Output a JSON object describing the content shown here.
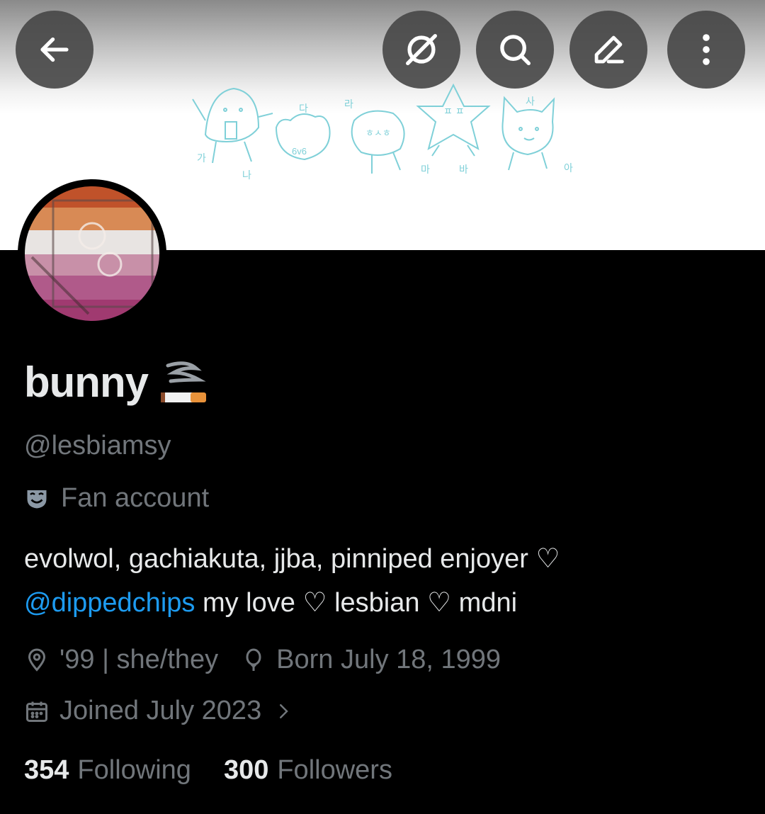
{
  "profile": {
    "display_name": "bunny",
    "name_emoji": "cigarette-emoji",
    "handle": "@lesbiamsy",
    "category": "Fan account",
    "bio_line1": "evolwol, gachiakuta, jjba, pinniped enjoyer ♡",
    "bio_mention": "@dippedchips",
    "bio_line2_rest": " my love ♡ lesbian ♡ mdni",
    "location": "'99 | she/they",
    "birthday": "Born July 18, 1999",
    "joined": "Joined July 2023",
    "following_count": "354",
    "following_label": "Following",
    "followers_count": "300",
    "followers_label": "Followers"
  },
  "banner": {
    "doodle_labels": [
      "가",
      "나",
      "다",
      "라",
      "마",
      "바",
      "사",
      "아",
      "ㅍ ㅍ",
      "6v6",
      "ㅎㅅㅎ"
    ]
  },
  "toolbar": {
    "icons": [
      "back-arrow-icon",
      "grok-icon",
      "search-icon",
      "edit-icon",
      "more-icon"
    ]
  },
  "colors": {
    "background": "#000000",
    "text_primary": "#e7e9ea",
    "text_secondary": "#71767b",
    "link": "#1d9bf0",
    "doodle": "#7fd0d8"
  }
}
